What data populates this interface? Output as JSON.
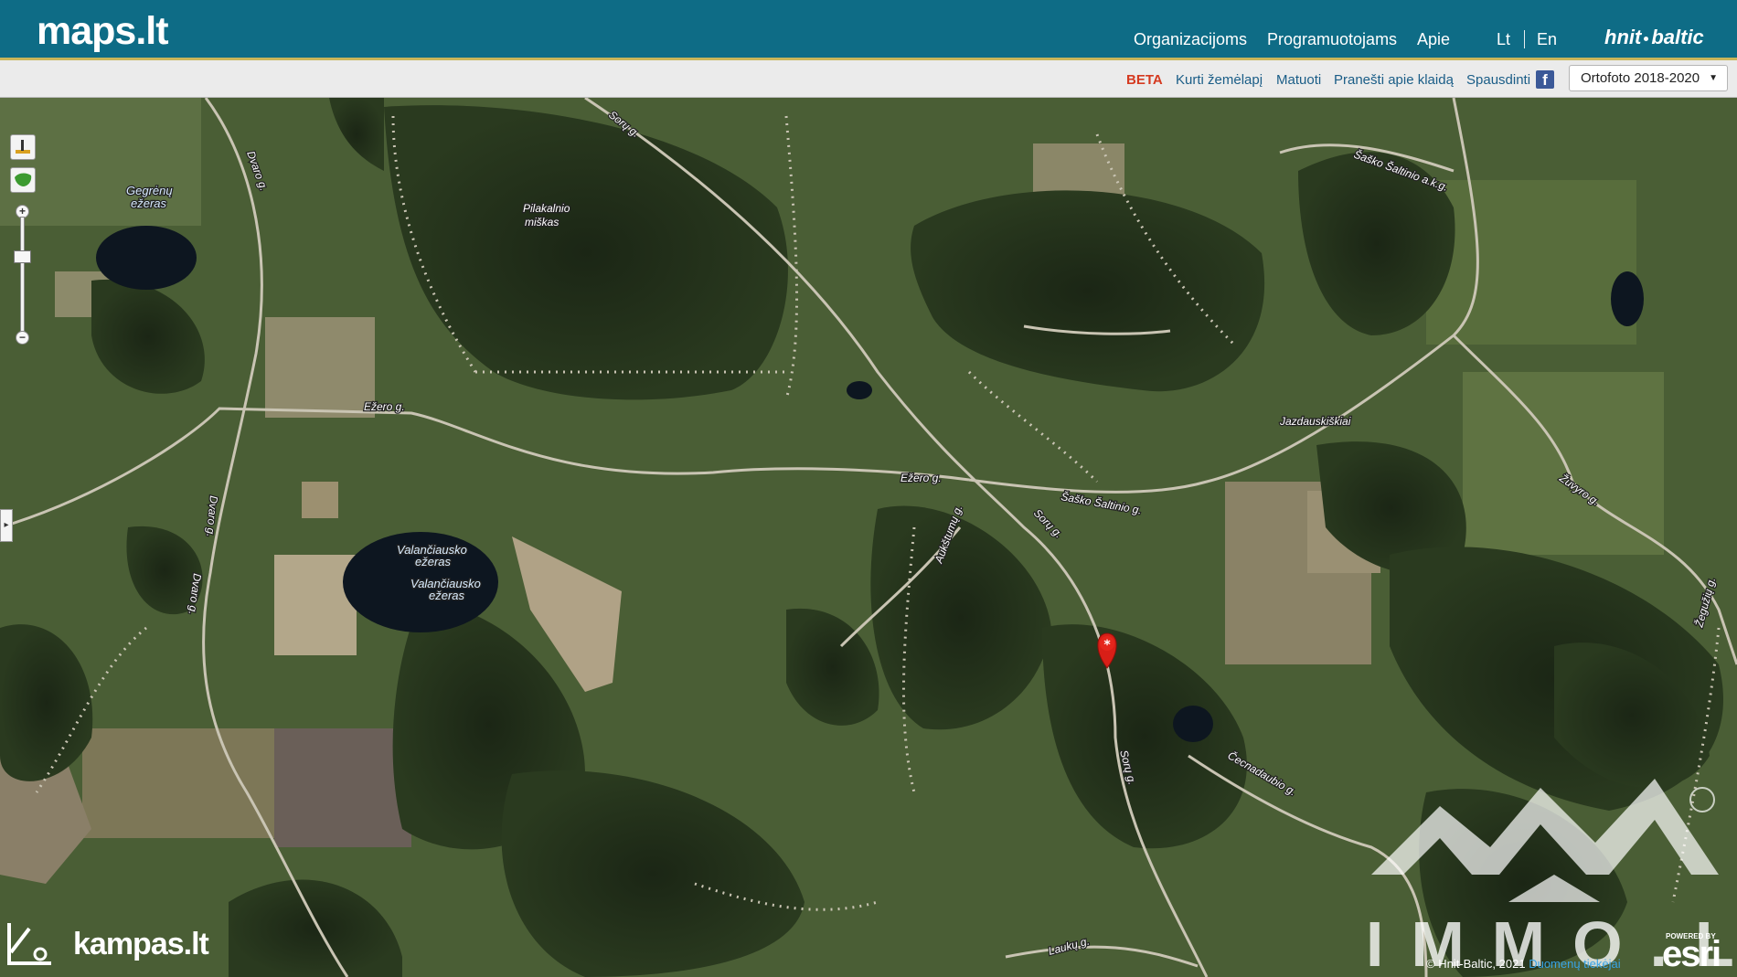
{
  "header": {
    "logo": "maps.lt",
    "nav": [
      {
        "label": "Organizacijoms"
      },
      {
        "label": "Programuotojams"
      },
      {
        "label": "Apie"
      }
    ],
    "languages": [
      {
        "label": "Lt"
      },
      {
        "label": "En"
      }
    ],
    "brand_left": "hnit",
    "brand_right": "baltic"
  },
  "toolbar": {
    "beta": "BETA",
    "links": [
      {
        "label": "Kurti žemėlapį"
      },
      {
        "label": "Matuoti"
      },
      {
        "label": "Pranešti apie klaidą"
      },
      {
        "label": "Spausdinti"
      }
    ],
    "facebook_icon": "facebook-icon",
    "layer_select": "Ortofoto 2018-2020"
  },
  "map": {
    "labels": {
      "lake1": "Gegrėnų",
      "lake1b": "ežeras",
      "forest1": "Pilakalnio",
      "forest1b": "miškas",
      "lake2": "Valančiausko",
      "lake2b": "ežeras",
      "lake3": "Valančiausko",
      "lake3b": "ežeras",
      "road_ezero_w": "Ežero g.",
      "road_ezero_c": "Ežero g.",
      "road_soriu_n": "Sorų g.",
      "road_soriu_c": "Sorų g.",
      "road_soriu_s": "Sorų g.",
      "road_dvaro_n": "Dvaro g.",
      "road_dvaro_c": "Dvaro g.",
      "road_dvaro_s": "Dvaro g.",
      "road_sasko_n": "Šaško Šaltinio a.k.g.",
      "road_sasko_c": "Šaško Šaltinio g.",
      "road_aukstumu": "Aukštumų g.",
      "village": "Jazdauskiškiai",
      "road_zuvyro": "Žuvyro g.",
      "road_cecnadaubio": "Čecnadaubio g.",
      "road_lauku": "Laukų g.",
      "road_zeguziu": "Žegužių g."
    },
    "marker_icon": "location-pin-icon",
    "controls": {
      "draw_icon": "ruler-tool-icon",
      "layer_icon": "lithuania-map-icon",
      "zoom_in": "+",
      "zoom_out": "−",
      "side_toggle": "▸"
    },
    "watermark": "IMMO.LT",
    "watermark_reg": "®",
    "kampas_logo": "kampas.lt",
    "attribution": "© Hnit-Baltic, 2021",
    "attribution_link": "Duomenų tiekėjai",
    "esri_powered": "POWERED BY",
    "esri_logo": "esri"
  }
}
